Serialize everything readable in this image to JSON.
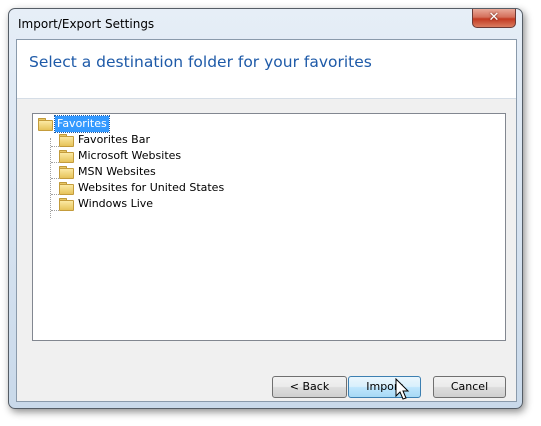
{
  "window": {
    "title": "Import/Export Settings",
    "close_glyph": "✕"
  },
  "header": {
    "text": "Select a destination folder for your favorites"
  },
  "tree": {
    "root": {
      "label": "Favorites",
      "selected": true,
      "icon": "folder-icon"
    },
    "children": [
      {
        "label": "Favorites Bar",
        "icon": "folder-icon"
      },
      {
        "label": "Microsoft Websites",
        "icon": "folder-icon"
      },
      {
        "label": "MSN Websites",
        "icon": "folder-icon"
      },
      {
        "label": "Websites for United States",
        "icon": "folder-icon"
      },
      {
        "label": "Windows Live",
        "icon": "folder-icon"
      }
    ]
  },
  "buttons": {
    "back_label": "< Back",
    "import_label": "Import",
    "cancel_label": "Cancel"
  },
  "colors": {
    "header_text": "#1e5aa8",
    "selection": "#3399ff"
  }
}
